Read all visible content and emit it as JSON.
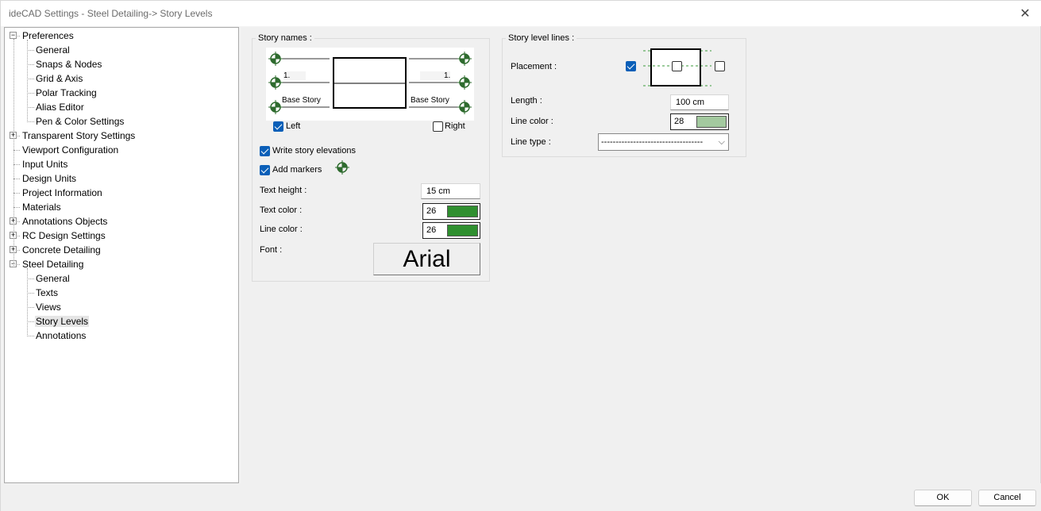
{
  "window": {
    "title": "ideCAD Settings - Steel Detailing-> Story Levels",
    "close_glyph": "✕"
  },
  "tree": {
    "items": [
      {
        "label": "Preferences",
        "level": 0,
        "expander": "−"
      },
      {
        "label": "General",
        "level": 1
      },
      {
        "label": "Snaps & Nodes",
        "level": 1
      },
      {
        "label": "Grid & Axis",
        "level": 1
      },
      {
        "label": "Polar Tracking",
        "level": 1
      },
      {
        "label": "Alias Editor",
        "level": 1
      },
      {
        "label": "Pen & Color Settings",
        "level": 1
      },
      {
        "label": "Transparent Story Settings",
        "level": 0,
        "expander": "+"
      },
      {
        "label": "Viewport Configuration",
        "level": 0
      },
      {
        "label": "Input Units",
        "level": 0
      },
      {
        "label": "Design Units",
        "level": 0
      },
      {
        "label": "Project Information",
        "level": 0
      },
      {
        "label": "Materials",
        "level": 0
      },
      {
        "label": "Annotations Objects",
        "level": 0,
        "expander": "+"
      },
      {
        "label": "RC Design Settings",
        "level": 0,
        "expander": "+"
      },
      {
        "label": "Concrete Detailing",
        "level": 0,
        "expander": "+"
      },
      {
        "label": "Steel Detailing",
        "level": 0,
        "expander": "−"
      },
      {
        "label": "General",
        "level": 1
      },
      {
        "label": "Texts",
        "level": 1
      },
      {
        "label": "Views",
        "level": 1
      },
      {
        "label": "Story Levels",
        "level": 1,
        "selected": true
      },
      {
        "label": "Annotations",
        "level": 1
      }
    ]
  },
  "story_names": {
    "title": "Story names :",
    "preview": {
      "left_num": "1.",
      "right_num": "1.",
      "left_base": "Base Story",
      "right_base": "Base Story"
    },
    "left_label": "Left",
    "left_checked": true,
    "right_label": "Right",
    "right_checked": false,
    "write_elevations_label": "Write story elevations",
    "write_elevations_checked": true,
    "add_markers_label": "Add markers",
    "add_markers_checked": true,
    "text_height_label": "Text height :",
    "text_height_value": "15 cm",
    "text_color_label": "Text color :",
    "text_color_value": "26",
    "text_color_hex": "#2f8f2f",
    "line_color_label": "Line color :",
    "line_color_value": "26",
    "line_color_hex": "#2f8f2f",
    "font_label": "Font :",
    "font_value": "Arial"
  },
  "story_level_lines": {
    "title": "Story level lines :",
    "placement_label": "Placement :",
    "placement_left_checked": true,
    "placement_center_checked": false,
    "placement_right_checked": false,
    "length_label": "Length :",
    "length_value": "100 cm",
    "line_color_label": "Line color :",
    "line_color_value": "28",
    "line_color_hex": "#a3c99f",
    "line_type_label": "Line type :",
    "line_type_value": "-----------------------------------",
    "line_type_arrow": "⌵"
  },
  "footer": {
    "ok_label": "OK",
    "cancel_label": "Cancel"
  },
  "colors": {
    "accent": "#0a5fb8",
    "marker_green": "#2e6b2e"
  }
}
